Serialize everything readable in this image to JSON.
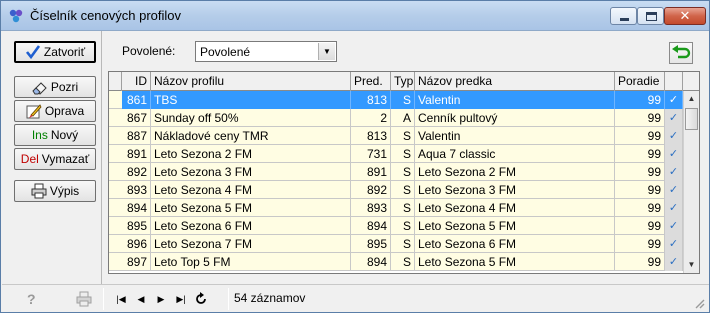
{
  "window": {
    "title": "Číselník cenových profilov",
    "close_label": "✕"
  },
  "sidebar": {
    "buttons": [
      {
        "label": "Zatvoriť",
        "icon": "checkmark-icon"
      },
      {
        "label": "Pozri",
        "icon": "eraser-icon"
      },
      {
        "label": "Oprava",
        "icon": "edit-pencil-icon"
      },
      {
        "prefix": "Ins",
        "label": "Nový"
      },
      {
        "prefix": "Del",
        "label": "Vymazať"
      },
      {
        "label": "Výpis",
        "icon": "printer-icon"
      }
    ]
  },
  "filter": {
    "label": "Povolené:",
    "value": "Povolené"
  },
  "grid": {
    "columns": [
      "ID",
      "Názov profilu",
      "Pred.",
      "Typ",
      "Názov predka",
      "Poradie",
      ""
    ],
    "rows": [
      {
        "id": "861",
        "name": "TBS",
        "pred": "813",
        "typ": "S",
        "parent": "Valentin",
        "order": "99",
        "check": "✓"
      },
      {
        "id": "867",
        "name": "Sunday off 50%",
        "pred": "2",
        "typ": "A",
        "parent": "Cenník pultový",
        "order": "99",
        "check": "✓"
      },
      {
        "id": "887",
        "name": "Nákladové ceny TMR",
        "pred": "813",
        "typ": "S",
        "parent": "Valentin",
        "order": "99",
        "check": "✓"
      },
      {
        "id": "891",
        "name": "Leto Sezona 2 FM",
        "pred": "731",
        "typ": "S",
        "parent": "Aqua 7 classic",
        "order": "99",
        "check": "✓"
      },
      {
        "id": "892",
        "name": "Leto Sezona 3 FM",
        "pred": "891",
        "typ": "S",
        "parent": "Leto Sezona 2 FM",
        "order": "99",
        "check": "✓"
      },
      {
        "id": "893",
        "name": "Leto Sezona 4 FM",
        "pred": "892",
        "typ": "S",
        "parent": "Leto Sezona 3 FM",
        "order": "99",
        "check": "✓"
      },
      {
        "id": "894",
        "name": "Leto Sezona 5 FM",
        "pred": "893",
        "typ": "S",
        "parent": "Leto Sezona 4 FM",
        "order": "99",
        "check": "✓"
      },
      {
        "id": "895",
        "name": "Leto Sezona 6 FM",
        "pred": "894",
        "typ": "S",
        "parent": "Leto Sezona 5 FM",
        "order": "99",
        "check": "✓"
      },
      {
        "id": "896",
        "name": "Leto Sezona 7 FM",
        "pred": "895",
        "typ": "S",
        "parent": "Leto Sezona 6 FM",
        "order": "99",
        "check": "✓"
      },
      {
        "id": "897",
        "name": "Leto Top 5 FM",
        "pred": "894",
        "typ": "S",
        "parent": "Leto Sezona 5 FM",
        "order": "99",
        "check": "✓"
      }
    ],
    "selected_index": 0
  },
  "statusbar": {
    "records": "54 záznamov",
    "nav": [
      "first-record-icon",
      "prev-record-icon",
      "next-record-icon",
      "last-record-icon",
      "refresh-icon"
    ]
  }
}
